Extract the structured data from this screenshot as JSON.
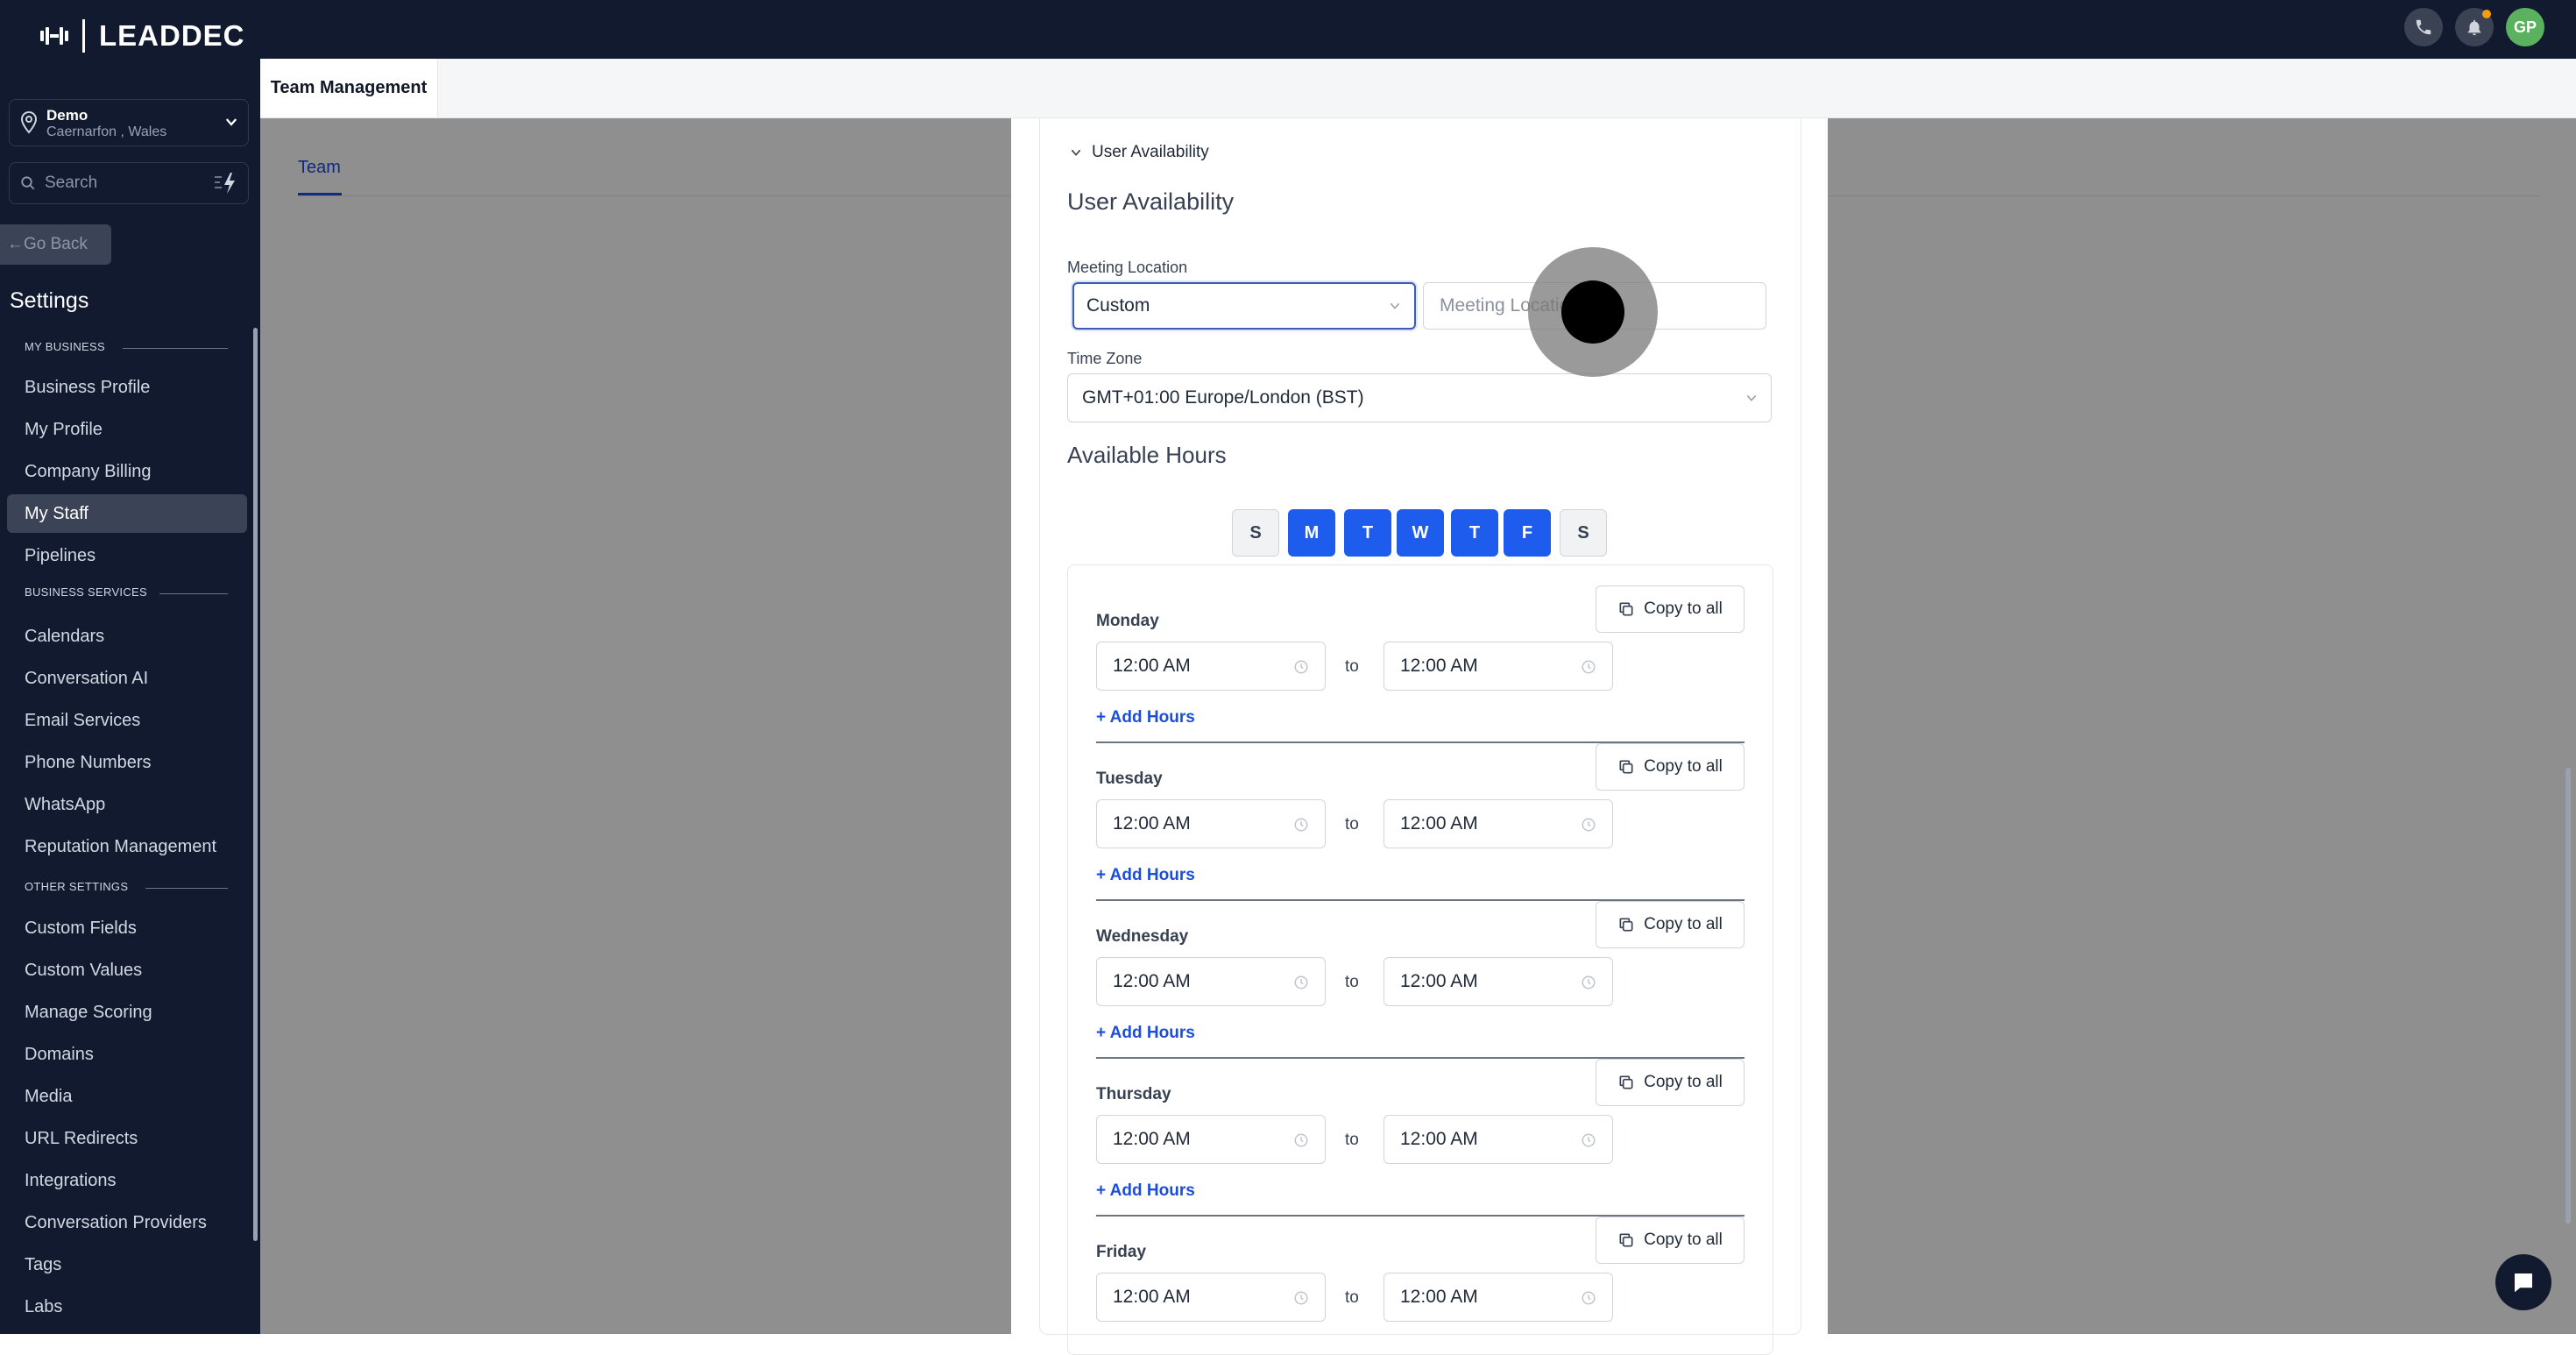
{
  "app": {
    "logo_text": "LEADDEC"
  },
  "topbar": {
    "avatar_initials": "GP"
  },
  "sidebar": {
    "location_name": "Demo",
    "location_sub": "Caernarfon , Wales",
    "search_placeholder": "Search",
    "go_back": "Go Back",
    "settings_title": "Settings",
    "sections": {
      "my_business": "MY BUSINESS",
      "business_services": "BUSINESS SERVICES",
      "other_settings": "OTHER SETTINGS"
    },
    "items": [
      "Business Profile",
      "My Profile",
      "Company Billing",
      "My Staff",
      "Pipelines",
      "Calendars",
      "Conversation AI",
      "Email Services",
      "Phone Numbers",
      "WhatsApp",
      "Reputation Management",
      "Custom Fields",
      "Custom Values",
      "Manage Scoring",
      "Domains",
      "Media",
      "URL Redirects",
      "Integrations",
      "Conversation Providers",
      "Tags",
      "Labs"
    ],
    "active_item": "My Staff"
  },
  "main": {
    "page_tab": "Team Management",
    "sub_tab": "Team"
  },
  "modal": {
    "accordion_label": "User Availability",
    "title": "User Availability",
    "meeting_location_label": "Meeting Location",
    "meeting_location_value": "Custom",
    "meeting_location_placeholder": "Meeting Location",
    "time_zone_label": "Time Zone",
    "time_zone_value": "GMT+01:00 Europe/London (BST)",
    "available_hours_title": "Available Hours",
    "days_toggle": [
      {
        "letter": "S",
        "on": false
      },
      {
        "letter": "M",
        "on": true
      },
      {
        "letter": "T",
        "on": true
      },
      {
        "letter": "W",
        "on": true
      },
      {
        "letter": "T",
        "on": true
      },
      {
        "letter": "F",
        "on": true
      },
      {
        "letter": "S",
        "on": false
      }
    ],
    "copy_label": "Copy to all",
    "to_label": "to",
    "add_hours_label": "+ Add Hours",
    "schedule": [
      {
        "day": "Monday",
        "start": "12:00 AM",
        "end": "12:00 AM"
      },
      {
        "day": "Tuesday",
        "start": "12:00 AM",
        "end": "12:00 AM"
      },
      {
        "day": "Wednesday",
        "start": "12:00 AM",
        "end": "12:00 AM"
      },
      {
        "day": "Thursday",
        "start": "12:00 AM",
        "end": "12:00 AM"
      },
      {
        "day": "Friday",
        "start": "12:00 AM",
        "end": "12:00 AM"
      }
    ]
  }
}
